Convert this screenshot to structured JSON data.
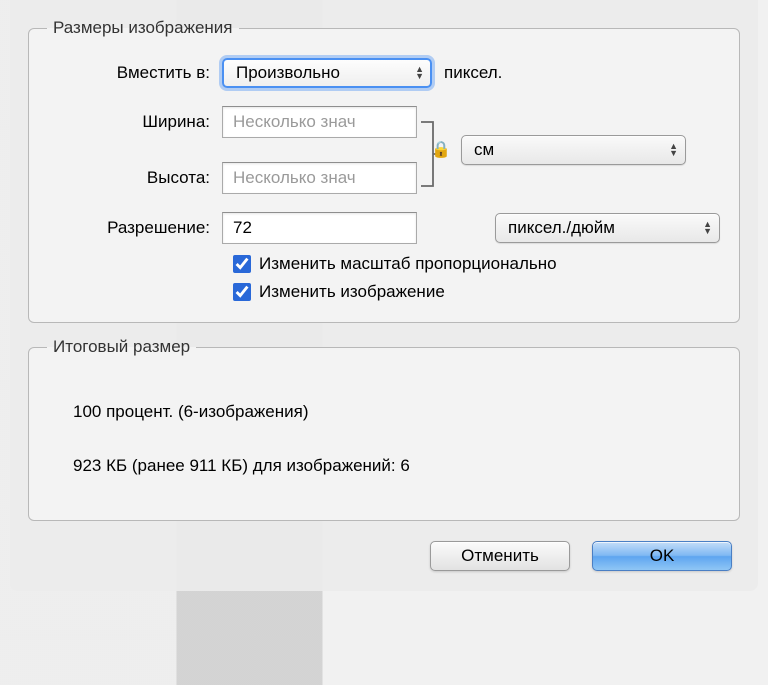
{
  "group_sizes": {
    "legend": "Размеры изображения",
    "fit_into_label": "Вместить в:",
    "fit_into_value": "Произвольно",
    "fit_into_unit": "пиксел.",
    "width_label": "Ширина:",
    "width_placeholder": "Несколько знач",
    "height_label": "Высота:",
    "height_placeholder": "Несколько знач",
    "units_value": "см",
    "resolution_label": "Разрешение:",
    "resolution_value": "72",
    "resolution_units": "пиксел./дюйм",
    "scale_proportional_label": "Изменить масштаб пропорционально",
    "resample_label": "Изменить изображение"
  },
  "group_result": {
    "legend": "Итоговый размер",
    "line1": "100 процент. (6-изображения)",
    "line2": "923 КБ (ранее 911 КБ) для изображений: 6"
  },
  "buttons": {
    "cancel": "Отменить",
    "ok": "OK"
  },
  "icons": {
    "up": "▲",
    "down": "▼",
    "lock": "🔒"
  }
}
